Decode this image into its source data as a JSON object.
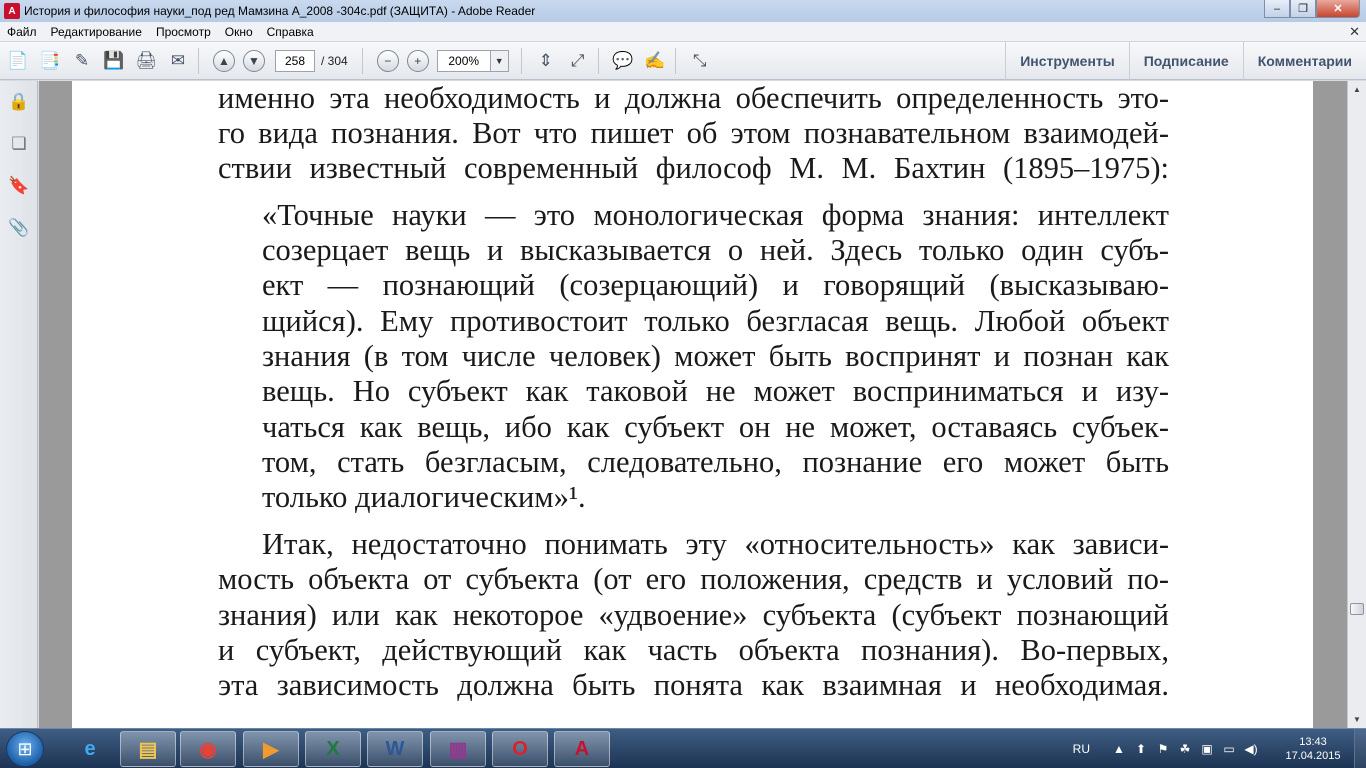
{
  "window": {
    "title": "История и философия науки_под ред Мамзина А_2008 -304с.pdf (ЗАЩИТА) - Adobe Reader",
    "controls": {
      "minimize": "‒",
      "maximize": "❐",
      "close": "✕"
    }
  },
  "menu": {
    "items": [
      "Файл",
      "Редактирование",
      "Просмотр",
      "Окно",
      "Справка"
    ],
    "close_glyph": "✕"
  },
  "toolbar": {
    "page_current": "258",
    "page_total": "/ 304",
    "zoom": "200%",
    "right_buttons": [
      "Инструменты",
      "Подписание",
      "Комментарии"
    ],
    "icons": {
      "create": "📄",
      "convert": "📑",
      "edit": "✎",
      "save": "💾",
      "print": "🖨",
      "email": "✉",
      "prev": "▲",
      "next": "▼",
      "zoom_out": "−",
      "zoom_in": "+",
      "zoom_arrow": "▼",
      "fit_page": "⇕",
      "fit_width": "⤢",
      "comment": "💬",
      "highlight": "✍",
      "fullscreen": "⤡"
    }
  },
  "left_panel": {
    "icons": {
      "lock": "🔒",
      "pages": "❏",
      "bookmarks": "🔖",
      "attachments": "📎"
    }
  },
  "document": {
    "lines": [
      {
        "text": "именно эта необходимость и должна обеспечить определенность это-",
        "j": true
      },
      {
        "text": "го вида познания. Вот что пишет об этом познавательном взаимодей-",
        "j": true
      },
      {
        "text": "ствии известный современный философ М. М. Бахтин (1895–1975):",
        "j": true
      },
      {
        "text": "«Точные науки — это монологическая форма знания: интеллект",
        "j": true
      },
      {
        "text": "созерцает вещь и высказывается о ней. Здесь только один субъ-",
        "j": true
      },
      {
        "text": "ект — познающий (созерцающий) и говорящий (высказываю-",
        "j": true
      },
      {
        "text": "щийся). Ему противостоит только безгласая вещь. Любой объект",
        "j": true
      },
      {
        "text": "знания (в том числе человек) может быть воспринят и познан как",
        "j": true
      },
      {
        "text": "вещь. Но субъект как таковой не может восприниматься и изу-",
        "j": true
      },
      {
        "text": "чаться как вещь, ибо как субъект он не может, оставаясь субъек-",
        "j": true
      },
      {
        "text": "том, стать безгласым, следовательно, познание его может быть",
        "j": true
      },
      {
        "text": "только диалогическим»¹.",
        "j": false
      },
      {
        "text": "Итак, недостаточно понимать эту «относительность» как зависи-",
        "j": true
      },
      {
        "text": "мость объекта от субъекта (от его положения, средств и условий по-",
        "j": true
      },
      {
        "text": "знания) или как некоторое «удвоение» субъекта (субъект познающий",
        "j": true
      },
      {
        "text": "и субъект, действующий как часть объекта познания). Во-первых,",
        "j": true
      },
      {
        "text": "эта зависимость должна быть понята как взаимная и необходимая.",
        "j": true
      }
    ]
  },
  "scrollbar": {
    "up": "▲",
    "down": "▼"
  },
  "taskbar": {
    "start_glyph": "⊞",
    "apps": [
      {
        "name": "ie",
        "glyph": "e",
        "color": "#3fa9f5"
      },
      {
        "name": "explorer",
        "glyph": "▤",
        "color": "#f3c74f"
      },
      {
        "name": "chrome",
        "glyph": "◉",
        "color": "#e94235"
      },
      {
        "name": "media",
        "glyph": "▶",
        "color": "#f19a2e"
      },
      {
        "name": "excel",
        "glyph": "X",
        "color": "#1e7b3c"
      },
      {
        "name": "word",
        "glyph": "W",
        "color": "#2b5797"
      },
      {
        "name": "winrar",
        "glyph": "▦",
        "color": "#8e3b8e"
      },
      {
        "name": "opera",
        "glyph": "O",
        "color": "#d9232d"
      },
      {
        "name": "acrobat",
        "glyph": "A",
        "color": "#c8102e"
      }
    ],
    "tray": {
      "lang": "RU",
      "icons": [
        "▲",
        "⬆",
        "⚑",
        "☘",
        "▣",
        "▭",
        "◀)"
      ],
      "time": "13:43",
      "date": "17.04.2015"
    }
  }
}
